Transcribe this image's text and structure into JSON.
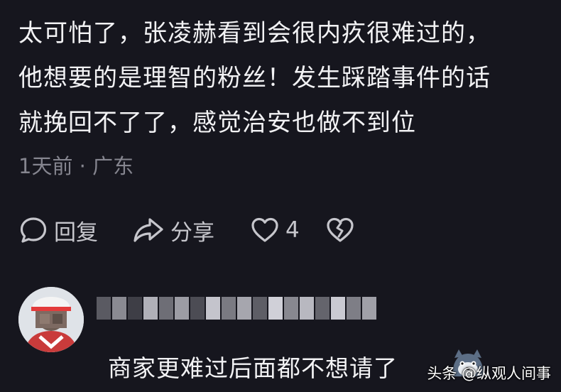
{
  "comment": {
    "lines": [
      "太可怕了，张凌赫看到会很内疚很难过的，",
      "他想要的是理智的粉丝！发生踩踏事件的话",
      "就挽回不了了，感觉治安也做不到位"
    ],
    "time": "1天前",
    "separator": "·",
    "location": "广东"
  },
  "actions": {
    "reply_label": "回复",
    "share_label": "分享",
    "like_count": "4",
    "icons": [
      "reply-bubble-icon",
      "share-arrow-icon",
      "heart-icon",
      "broken-heart-icon"
    ]
  },
  "reply": {
    "text": "商家更难过后面都不想请了"
  },
  "watermark": {
    "text": "头条 @纵观人间事"
  },
  "colors": {
    "background": "#16161e",
    "text": "#f2f2f4",
    "meta": "#85858f",
    "icons": "#c6c6cc"
  }
}
